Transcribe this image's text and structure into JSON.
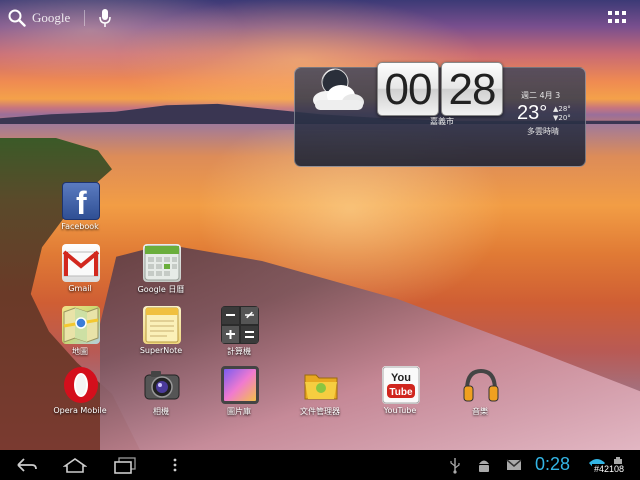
{
  "search": {
    "label": "Google"
  },
  "clock": {
    "hours": "00",
    "minutes": "28",
    "city": "嘉義市",
    "date": "週二 4月 3",
    "temp_current": "23°",
    "temp_high": "▲28°",
    "temp_low": "▼20°",
    "condition": "多雲時晴"
  },
  "apps": {
    "facebook": "Facebook",
    "gmail": "Gmail",
    "google_calendar": "Google 日曆",
    "maps": "地圖",
    "supernote": "SuperNote",
    "calculator": "計算機",
    "opera": "Opera Mobile",
    "camera": "相機",
    "gallery": "圖片庫",
    "file_manager": "文件管理器",
    "youtube": "YouTube",
    "music": "音樂",
    "youtube_logo_text": "You",
    "youtube_logo_tube": "Tube"
  },
  "status": {
    "time": "0:28",
    "tag": "#42108"
  },
  "colors": {
    "accent": "#33b5e5"
  }
}
